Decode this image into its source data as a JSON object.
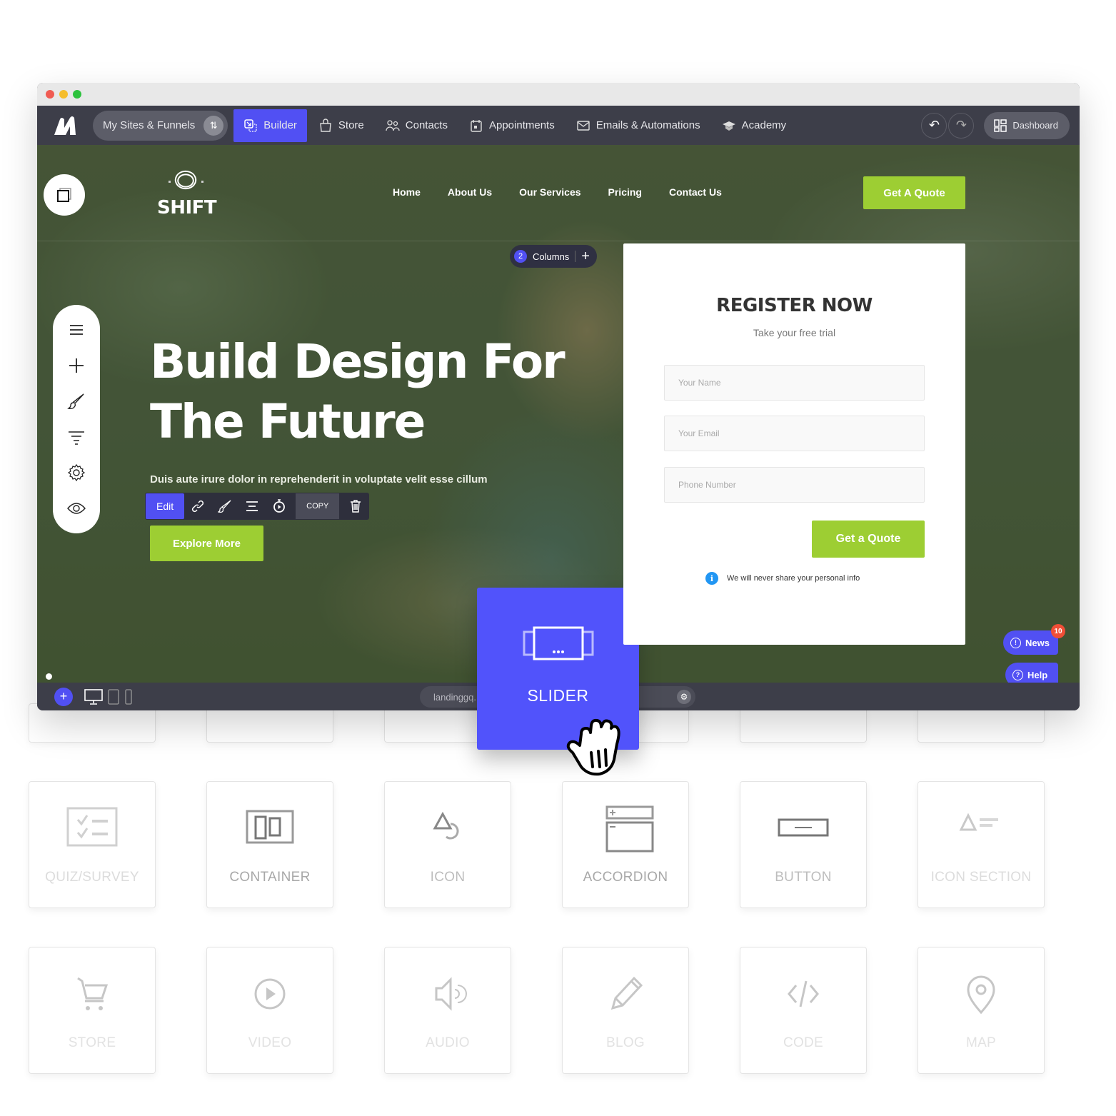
{
  "widgets": {
    "row_top": [
      "",
      "",
      "",
      "",
      "",
      ""
    ],
    "row_middle": [
      {
        "label": "QUIZ/SURVEY",
        "icon": "quiz-checklist-icon"
      },
      {
        "label": "CONTAINER",
        "icon": "container-columns-icon"
      },
      {
        "label": "ICON",
        "icon": "shapes-icon"
      },
      {
        "label": "ACCORDION",
        "icon": "accordion-icon"
      },
      {
        "label": "BUTTON",
        "icon": "button-icon"
      },
      {
        "label": "ICON SECTION",
        "icon": "icon-section-icon"
      }
    ],
    "row_bottom": [
      {
        "label": "STORE",
        "icon": "cart-icon"
      },
      {
        "label": "VIDEO",
        "icon": "play-circle-icon"
      },
      {
        "label": "AUDIO",
        "icon": "speaker-icon"
      },
      {
        "label": "BLOG",
        "icon": "pencil-icon"
      },
      {
        "label": "CODE",
        "icon": "code-icon"
      },
      {
        "label": "MAP",
        "icon": "map-pin-icon"
      }
    ],
    "dragging": {
      "label": "SLIDER",
      "icon": "slider-icon"
    }
  },
  "appbar": {
    "sites_label": "My Sites & Funnels",
    "nav": [
      {
        "label": "Builder",
        "icon": "builder-icon",
        "active": true
      },
      {
        "label": "Store",
        "icon": "shopping-bag-icon"
      },
      {
        "label": "Contacts",
        "icon": "contacts-icon"
      },
      {
        "label": "Appointments",
        "icon": "calendar-icon"
      },
      {
        "label": "Emails & Automations",
        "icon": "mail-icon"
      },
      {
        "label": "Academy",
        "icon": "graduation-cap-icon"
      }
    ],
    "dashboard_label": "Dashboard"
  },
  "site": {
    "logo_text": "SHIFT",
    "nav": [
      "Home",
      "About Us",
      "Our Services",
      "Pricing",
      "Contact Us"
    ],
    "cta_label": "Get A Quote",
    "columns": {
      "count": "2",
      "label": "Columns"
    },
    "hero_title_line1": "Build Design For",
    "hero_title_line2": "The Future",
    "hero_text": "Duis aute irure dolor in reprehenderit in voluptate velit esse cillum dolore eu fugiat nulla pariatur.",
    "explore_label": "Explore More",
    "edit_toolbar": {
      "edit_label": "Edit",
      "copy_label": "COPY"
    },
    "form": {
      "title": "REGISTER NOW",
      "subtitle": "Take your free trial",
      "fields": [
        {
          "placeholder": "Your Name",
          "value": ""
        },
        {
          "placeholder": "Your Email",
          "value": ""
        },
        {
          "placeholder": "Phone Number",
          "value": ""
        }
      ],
      "submit_label": "Get a Quote",
      "note": "We will never share your personal info"
    }
  },
  "floating": {
    "news_label": "News",
    "news_count": "10",
    "help_label": "Help"
  },
  "bottombar": {
    "url": "landinggq."
  },
  "colors": {
    "accent": "#5150f3",
    "cta_green": "#9dce33",
    "appbar_bg": "#3d3e49",
    "badge_red": "#f04e37",
    "info_blue": "#2196f3"
  }
}
